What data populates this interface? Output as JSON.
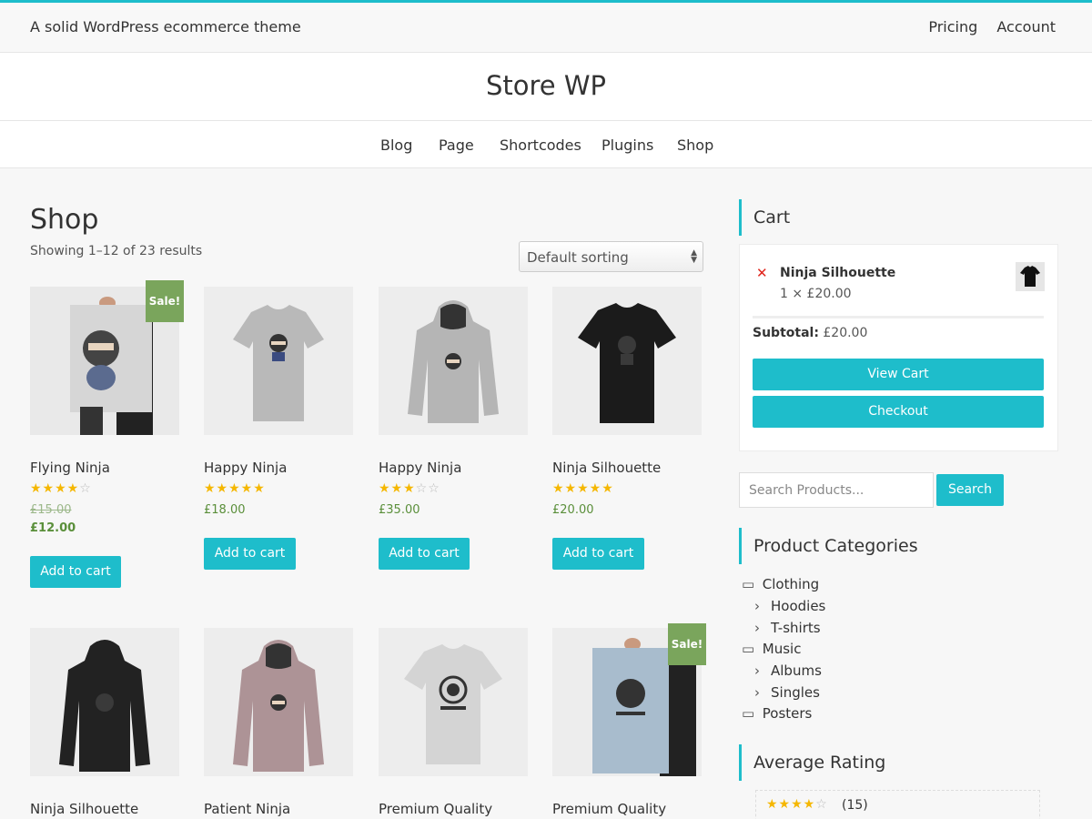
{
  "topbar": {
    "tagline": "A solid WordPress ecommerce theme",
    "links": [
      "Pricing",
      "Account"
    ]
  },
  "site": {
    "title": "Store WP"
  },
  "nav": {
    "items": [
      "Blog",
      "Page",
      "Shortcodes",
      "Plugins",
      "Shop"
    ]
  },
  "shop": {
    "title": "Shop",
    "result_count": "Showing 1–12 of 23 results",
    "sorting": "Default sorting",
    "sale_badge": "Sale!",
    "add_to_cart": "Add to cart",
    "products": [
      {
        "name": "Flying Ninja",
        "rating": 4,
        "old_price": "£15.00",
        "price": "£12.00",
        "on_sale": true
      },
      {
        "name": "Happy Ninja",
        "rating": 5,
        "price": "£18.00"
      },
      {
        "name": "Happy Ninja",
        "rating": 3,
        "price": "£35.00"
      },
      {
        "name": "Ninja Silhouette",
        "rating": 5,
        "price": "£20.00"
      },
      {
        "name": "Ninja Silhouette"
      },
      {
        "name": "Patient Ninja"
      },
      {
        "name": "Premium Quality"
      },
      {
        "name": "Premium Quality",
        "on_sale": true
      }
    ]
  },
  "cart": {
    "title": "Cart",
    "item_name": "Ninja Silhouette",
    "item_qty": "1 × £20.00",
    "subtotal_label": "Subtotal:",
    "subtotal_value": "£20.00",
    "view_cart": "View Cart",
    "checkout": "Checkout"
  },
  "search": {
    "placeholder": "Search Products...",
    "button": "Search"
  },
  "categories": {
    "title": "Product Categories",
    "items": [
      "Clothing",
      "Hoodies",
      "T-shirts",
      "Music",
      "Albums",
      "Singles",
      "Posters"
    ]
  },
  "average_rating": {
    "title": "Average Rating",
    "rating": 4,
    "count": "(15)"
  },
  "colors": {
    "accent": "#1ebdcb",
    "sale": "#7aa55c",
    "price": "#5a8f3a",
    "star": "#f5b701"
  }
}
